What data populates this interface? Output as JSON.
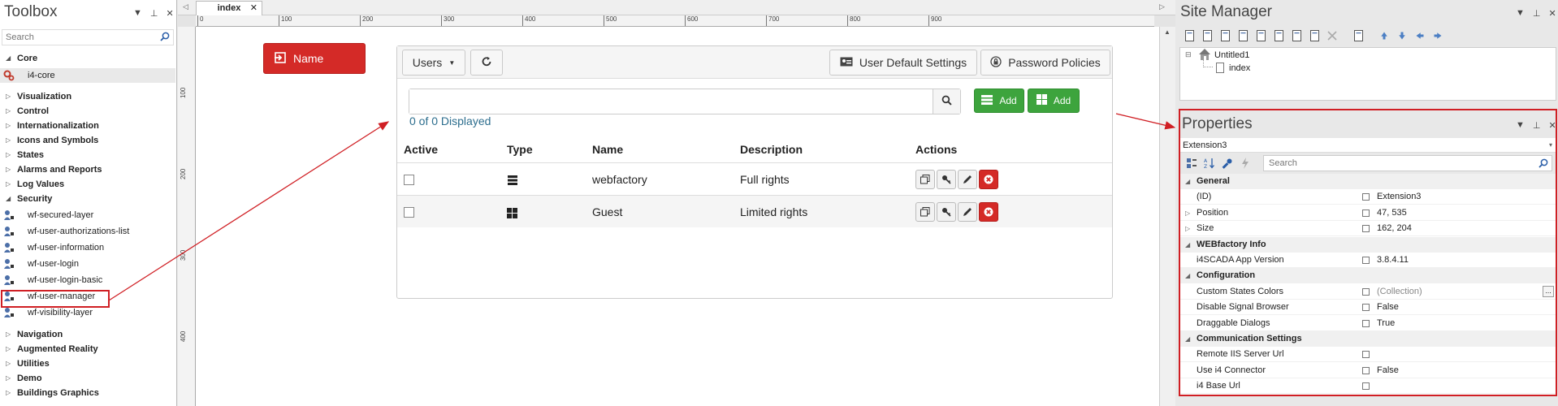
{
  "toolbox": {
    "title": "Toolbox",
    "search_placeholder": "Search",
    "core_label": "Core",
    "core_item": "i4-core",
    "categories": [
      "Visualization",
      "Control",
      "Internationalization",
      "Icons and Symbols",
      "States",
      "Alarms and Reports",
      "Log Values"
    ],
    "security_label": "Security",
    "security_items": [
      "wf-secured-layer",
      "wf-user-authorizations-list",
      "wf-user-information",
      "wf-user-login",
      "wf-user-login-basic",
      "wf-user-manager",
      "wf-visibility-layer"
    ],
    "bottom_categories": [
      "Navigation",
      "Augmented Reality",
      "Utilities",
      "Demo",
      "Buildings Graphics"
    ]
  },
  "designer": {
    "tab_label": "index",
    "ruler_h": [
      "0",
      "100",
      "200",
      "300",
      "400",
      "500",
      "600",
      "700",
      "800",
      "900"
    ],
    "ruler_v": [
      "100",
      "200",
      "300",
      "400"
    ],
    "name_button": "Name"
  },
  "user_manager": {
    "users_button": "Users",
    "user_default_settings": "User Default Settings",
    "password_policies": "Password Policies",
    "add_label": "Add",
    "count_text": "0 of 0 Displayed",
    "columns": [
      "Active",
      "Type",
      "Name",
      "Description",
      "Actions"
    ],
    "rows": [
      {
        "name": "webfactory",
        "description": "Full rights",
        "type_icon": "server-icon"
      },
      {
        "name": "Guest",
        "description": "Limited rights",
        "type_icon": "windows-icon"
      }
    ]
  },
  "site_manager": {
    "title": "Site Manager",
    "tree_root": "Untitled1",
    "tree_child": "index"
  },
  "properties": {
    "title": "Properties",
    "selected_object": "Extension3",
    "search_placeholder": "Search",
    "rows": [
      {
        "kind": "cat",
        "name": "General"
      },
      {
        "kind": "prop",
        "name": "(ID)",
        "value": "Extension3"
      },
      {
        "kind": "prop",
        "name": "Position",
        "value": "47, 535",
        "expandable": true
      },
      {
        "kind": "prop",
        "name": "Size",
        "value": "162, 204",
        "expandable": true
      },
      {
        "kind": "cat",
        "name": "WEBfactory Info"
      },
      {
        "kind": "prop",
        "name": "i4SCADA App Version",
        "value": "3.8.4.11"
      },
      {
        "kind": "cat",
        "name": "Configuration"
      },
      {
        "kind": "prop",
        "name": "Custom States Colors",
        "value": "(Collection)",
        "dim": true,
        "ellipsis": true
      },
      {
        "kind": "prop",
        "name": "Disable Signal Browser",
        "value": "False"
      },
      {
        "kind": "prop",
        "name": "Draggable Dialogs",
        "value": "True"
      },
      {
        "kind": "cat",
        "name": "Communication Settings"
      },
      {
        "kind": "prop",
        "name": "Remote IIS Server Url",
        "value": ""
      },
      {
        "kind": "prop",
        "name": "Use i4 Connector",
        "value": "False"
      },
      {
        "kind": "prop",
        "name": "i4 Base Url",
        "value": ""
      }
    ]
  },
  "colors": {
    "accent_red": "#d42a27",
    "add_green": "#3da43d",
    "highlight_red": "#d01f24",
    "count_text": "#2d6e8e"
  }
}
